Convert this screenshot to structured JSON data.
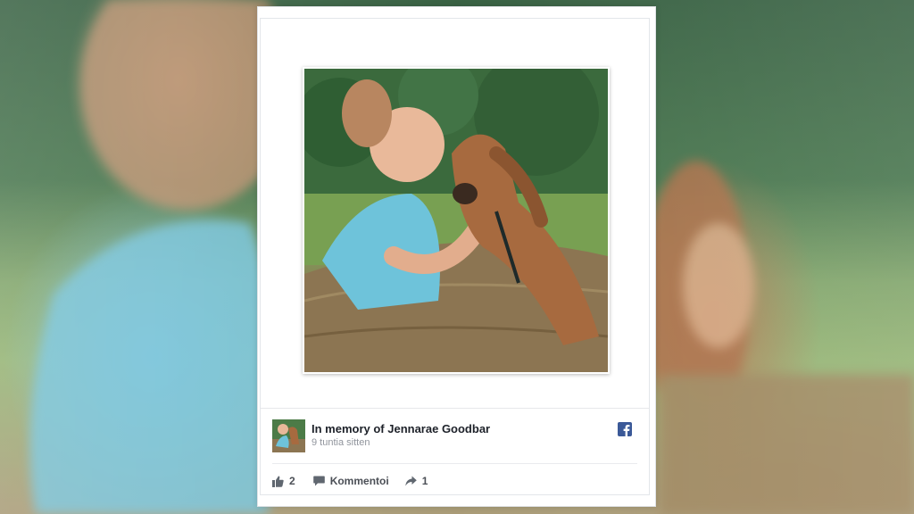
{
  "post": {
    "title": "In memory of Jennarae Goodbar",
    "time": "9 tuntia sitten"
  },
  "actions": {
    "likes": "2",
    "comment_label": "Kommentoi",
    "shares": "1"
  },
  "icons": {
    "platform": "facebook-icon",
    "like": "thumbs-up-icon",
    "comment": "speech-bubble-icon",
    "share": "share-arrow-icon"
  },
  "colors": {
    "facebook_blue": "#3b5998",
    "title_text": "#1d2129",
    "meta_text": "#90949c"
  }
}
